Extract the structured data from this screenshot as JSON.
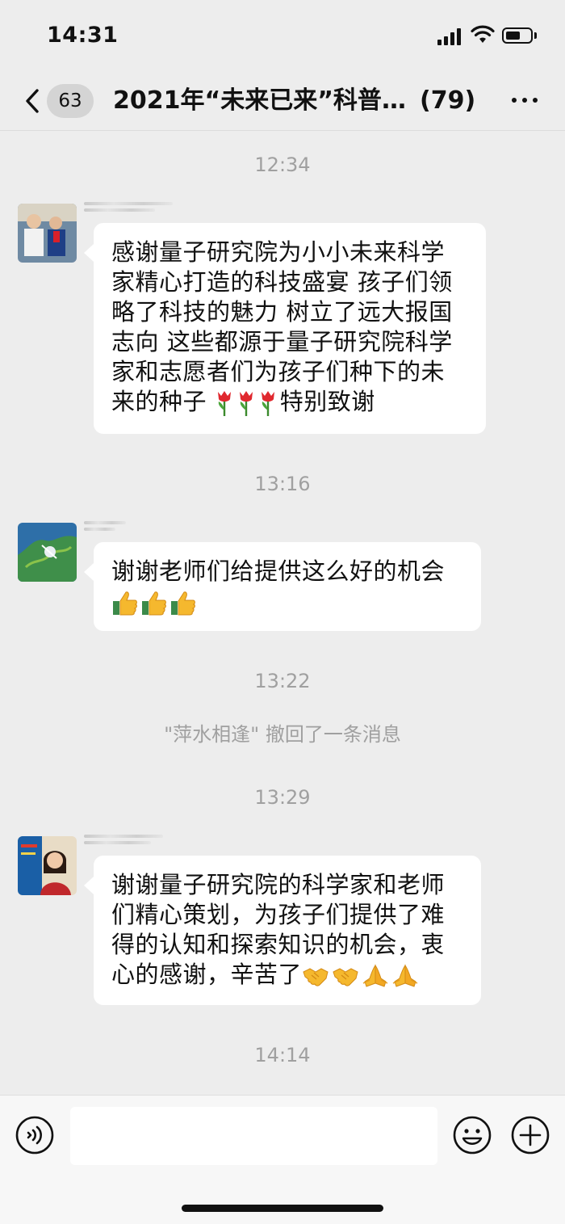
{
  "status_bar": {
    "time": "14:31",
    "battery_level": 0.6
  },
  "nav": {
    "back_icon": "chevron-left-icon",
    "unread_count": "63",
    "title": "2021年“未来已来”科普...",
    "member_count": "(79)",
    "more_icon": "more-dots-icon"
  },
  "messages": [
    {
      "time": "12:34",
      "text": "感谢量子研究院为小小未来科学家精心打造的科技盛宴 孩子们领略了科技的魅力 树立了远大报国志向 这些都源于量子研究院科学家和志愿者们为孩子们种下的未来的种子",
      "emoji": [
        "tulip-icon",
        "tulip-icon",
        "tulip-icon"
      ],
      "text_after": "特别致谢"
    },
    {
      "time": "13:16",
      "text": "谢谢老师们给提供这么好的机会",
      "emoji": [
        "thumbs-up-icon",
        "thumbs-up-icon",
        "thumbs-up-icon"
      ]
    },
    {
      "time": "13:22",
      "system_notice": "\"萍水相逢\" 撤回了一条消息"
    },
    {
      "time": "13:29",
      "text": "谢谢量子研究院的科学家和老师们精心策划，为孩子们提供了难得的认知和探索知识的机会，衷心的感谢，辛苦了",
      "emoji": [
        "handshake-icon",
        "handshake-icon",
        "praying-hands-icon",
        "praying-hands-icon"
      ]
    },
    {
      "time": "14:14"
    }
  ],
  "input_bar": {
    "voice_icon": "voice-icon",
    "input_value": "",
    "emoji_icon": "smiley-icon",
    "plus_icon": "plus-icon"
  },
  "colors": {
    "background": "#ededed",
    "bubble": "#ffffff",
    "timestamp": "#a0a0a0",
    "input_bar": "#f7f7f7"
  }
}
